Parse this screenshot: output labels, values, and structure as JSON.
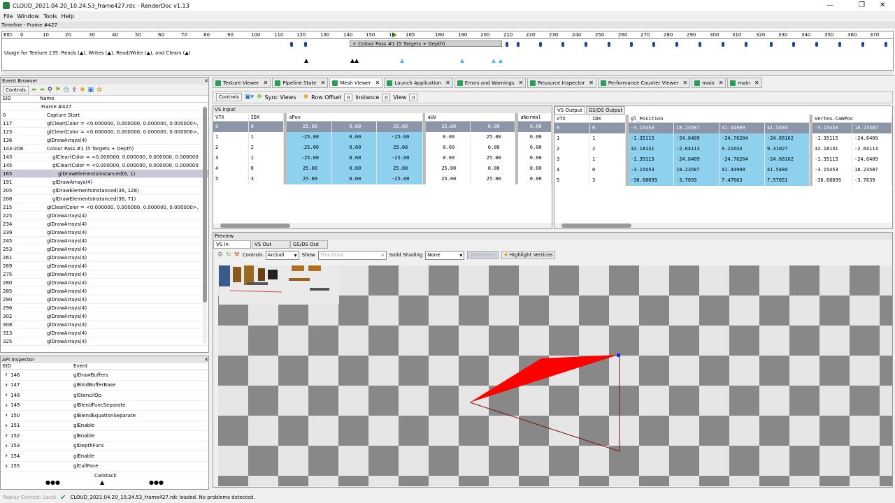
{
  "window": {
    "title": "CLOUD_2021.04.20_10.24.53_frame427.rdc - RenderDoc v1.13",
    "min": "—",
    "max": "❐",
    "close": "✕"
  },
  "menu": [
    "File",
    "Window",
    "Tools",
    "Help"
  ],
  "timeline": {
    "title": "Timeline - Frame #427",
    "eid_label": "EID:",
    "ticks": [
      "0",
      "10",
      "20",
      "30",
      "40",
      "50",
      "60",
      "70",
      "80",
      "90",
      "100",
      "110",
      "120",
      "130",
      "140",
      "150",
      "16",
      "165",
      "180",
      "190",
      "200",
      "210",
      "220",
      "230",
      "240",
      "250",
      "260",
      "270",
      "280",
      "290",
      "300",
      "310",
      "320",
      "330",
      "340",
      "350",
      "360",
      "370"
    ],
    "colour_pass": "+ Colour Pass #1 (5 Targets + Depth)",
    "usage": "Usage for Texture 135: Reads (▲), Writes (▲), Read/Write (▲), and Clears (▲)"
  },
  "event_browser": {
    "title": "Event Browser",
    "controls": "Controls",
    "columns": [
      "EID",
      "Name"
    ],
    "rows": [
      {
        "eid": "",
        "name": "Frame #427",
        "indent": 1
      },
      {
        "eid": "0",
        "name": "Capture Start",
        "indent": 2
      },
      {
        "eid": "117",
        "name": "glClear(Color = <0.000000, 0.000000, 0.000000, 0.000000>,",
        "indent": 2
      },
      {
        "eid": "123",
        "name": "glClear(Color = <0.000000, 0.000000, 0.000000, 0.000000>,",
        "indent": 2
      },
      {
        "eid": "136",
        "name": "glDrawArrays(4)",
        "indent": 2
      },
      {
        "eid": "143-208",
        "name": "Colour Pass #1 (5 Targets + Depth)",
        "indent": 2
      },
      {
        "eid": "143",
        "name": "glClear(Color = <0.000000, 0.000000, 0.000000, 0.000000",
        "indent": 3
      },
      {
        "eid": "145",
        "name": "glClear(Color = <0.000000, 0.000000, 0.000000, 0.000000>)",
        "indent": 3
      },
      {
        "eid": "165",
        "name": "glDrawElementsInstanced(6, 1)",
        "indent": 4,
        "selected": true
      },
      {
        "eid": "191",
        "name": "glDrawArrays(4)",
        "indent": 3
      },
      {
        "eid": "205",
        "name": "glDrawElementsInstanced(36, 128)",
        "indent": 3
      },
      {
        "eid": "208",
        "name": "glDrawElementsInstanced(36, 71)",
        "indent": 3
      },
      {
        "eid": "215",
        "name": "glClear(Color = <0.000000, 0.000000, 0.000000, 0.000000>,",
        "indent": 2
      },
      {
        "eid": "225",
        "name": "glDrawArrays(4)",
        "indent": 2
      },
      {
        "eid": "234",
        "name": "glDrawArrays(4)",
        "indent": 2
      },
      {
        "eid": "239",
        "name": "glDrawArrays(4)",
        "indent": 2
      },
      {
        "eid": "245",
        "name": "glDrawArrays(4)",
        "indent": 2
      },
      {
        "eid": "253",
        "name": "glDrawArrays(4)",
        "indent": 2
      },
      {
        "eid": "261",
        "name": "glDrawArrays(4)",
        "indent": 2
      },
      {
        "eid": "269",
        "name": "glDrawArrays(4)",
        "indent": 2
      },
      {
        "eid": "275",
        "name": "glDrawArrays(4)",
        "indent": 2
      },
      {
        "eid": "280",
        "name": "glDrawArrays(4)",
        "indent": 2
      },
      {
        "eid": "285",
        "name": "glDrawArrays(4)",
        "indent": 2
      },
      {
        "eid": "290",
        "name": "glDrawArrays(4)",
        "indent": 2
      },
      {
        "eid": "296",
        "name": "glDrawArrays(4)",
        "indent": 2
      },
      {
        "eid": "302",
        "name": "glDrawArrays(4)",
        "indent": 2
      },
      {
        "eid": "308",
        "name": "glDrawArrays(4)",
        "indent": 2
      },
      {
        "eid": "313",
        "name": "glDrawArrays(4)",
        "indent": 2
      },
      {
        "eid": "325",
        "name": "glDrawArrays(4)",
        "indent": 2
      }
    ]
  },
  "api_inspector": {
    "title": "API Inspector",
    "columns": [
      "EID",
      "Event"
    ],
    "rows": [
      {
        "eid": "146",
        "event": "glDrawBuffers"
      },
      {
        "eid": "147",
        "event": "glBindBufferBase"
      },
      {
        "eid": "148",
        "event": "glStencilOp"
      },
      {
        "eid": "149",
        "event": "glBlendFuncSeparate"
      },
      {
        "eid": "150",
        "event": "glBlendEquationSeparate"
      },
      {
        "eid": "151",
        "event": "glEnable"
      },
      {
        "eid": "152",
        "event": "glEnable"
      },
      {
        "eid": "153",
        "event": "glDepthFunc"
      },
      {
        "eid": "154",
        "event": "glEnable"
      },
      {
        "eid": "155",
        "event": "glCullFace"
      }
    ],
    "callstack": "Callstack",
    "more": "●●●"
  },
  "tabs": [
    "Texture Viewer",
    "Pipeline State",
    "Mesh Viewer",
    "Launch Application",
    "Errors and Warnings",
    "Resource Inspector",
    "Performance Counter Viewer",
    "main",
    "main"
  ],
  "active_tab": "Mesh Viewer",
  "mesh_toolbar": {
    "controls": "Controls",
    "sync": "Sync Views",
    "row_offset": "Row Offset",
    "row_offset_val": "0",
    "instance": "Instance",
    "instance_val": "0",
    "view": "View",
    "view_val": "0"
  },
  "vs_input": {
    "title": "VS Input",
    "headers": [
      "VTX",
      "IDX",
      "aPos",
      "aUV",
      "aNormal"
    ],
    "rows": [
      [
        "0",
        "0",
        "25.00",
        "0.00",
        "25.00",
        "25.00",
        "0.00",
        "0.00"
      ],
      [
        "1",
        "1",
        "-25.00",
        "0.00",
        "-25.00",
        "0.00",
        "25.00",
        "0.00"
      ],
      [
        "2",
        "2",
        "-25.00",
        "0.00",
        "25.00",
        "0.00",
        "0.00",
        "0.00"
      ],
      [
        "3",
        "1",
        "-25.00",
        "0.00",
        "-25.00",
        "0.00",
        "25.00",
        "0.00"
      ],
      [
        "4",
        "0",
        "25.00",
        "0.00",
        "25.00",
        "25.00",
        "0.00",
        "0.00"
      ],
      [
        "5",
        "3",
        "25.00",
        "0.00",
        "-25.00",
        "25.00",
        "25.00",
        "0.00"
      ]
    ]
  },
  "vs_output": {
    "tabs": [
      "VS Output",
      "GS/DS Output"
    ],
    "headers": [
      "VTX",
      "IDX",
      "gl_Position",
      "Vertex.CamPos"
    ],
    "rows": [
      [
        "0",
        "0",
        "-3.15453",
        "18.23587",
        "41.44909",
        "41.5484",
        "-3.15453",
        "18.23587"
      ],
      [
        "1",
        "1",
        "-1.35115",
        "-24.6409",
        "-24.76204",
        "-24.66162",
        "-1.35115",
        "-24.6409"
      ],
      [
        "2",
        "2",
        "32.18131",
        "-2.64113",
        "9.21043",
        "9.31027",
        "32.18131",
        "-2.64113"
      ],
      [
        "3",
        "1",
        "-1.35115",
        "-24.6409",
        "-24.76204",
        "-24.66162",
        "-1.35115",
        "-24.6409"
      ],
      [
        "4",
        "0",
        "-3.15453",
        "18.23587",
        "41.44909",
        "41.5484",
        "-3.15453",
        "18.23587"
      ],
      [
        "5",
        "3",
        "-36.68699",
        "-3.7639",
        "7.47663",
        "7.57651",
        "-36.68699",
        "-3.7639"
      ]
    ]
  },
  "preview": {
    "title": "Preview",
    "tabs": [
      "VS In",
      "VS Out",
      "GS/DS Out"
    ],
    "controls": "Controls",
    "camera": "Arcball",
    "show": "Show",
    "show_val": "This draw",
    "solid": "Solid Shading",
    "solid_val": "None",
    "wireframe": "Wireframe",
    "highlight": "Highlight Vertices",
    "mesh_color": "#ff0000"
  },
  "status": {
    "context": "Replay Context: Local",
    "message": "CLOUD_2021.04.20_10.24.53_frame427.rdc loaded. No problems detected."
  }
}
